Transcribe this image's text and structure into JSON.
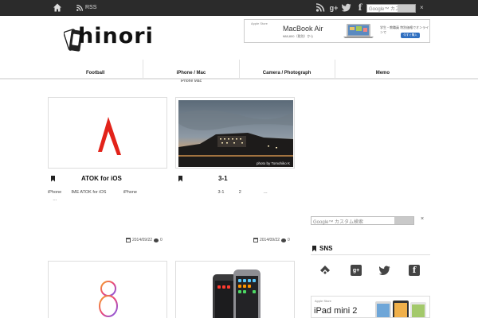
{
  "topbar": {
    "rss_label": "RSS",
    "search_placeholder": "Google™ カス",
    "close_label": "×"
  },
  "header": {
    "logo_text": "hinori",
    "ad": {
      "brand": "Apple Store",
      "title": "MacBook Air",
      "price": "¥88,800（税別）から",
      "small": "学生・教職員 特別価格でオンラインで",
      "button": "今すぐ購入"
    }
  },
  "nav": {
    "items": [
      {
        "label": "Football",
        "sub": ""
      },
      {
        "label": "iPhone / Mac",
        "sub": "iPhone  Mac"
      },
      {
        "label": "Camera / Photograph",
        "sub": ""
      },
      {
        "label": "Memo",
        "sub": ""
      }
    ]
  },
  "posts": [
    {
      "title": "ATOK for iOS",
      "excerpt": "iPhone        IME ATOK for iOS              iPhone\n    …",
      "date": "2014/09/22",
      "comments": "0"
    },
    {
      "title": "3-1",
      "excerpt": "                                   3-1            2                  …",
      "date": "2014/09/22",
      "comments": "0",
      "watermark": "photo by Tomohiko K"
    }
  ],
  "sidebar": {
    "search_placeholder": "Google™ カスタム検索",
    "close_label": "×",
    "sns_title": "SNS",
    "ad": {
      "brand": "Apple Store",
      "title": "iPad mini 2"
    }
  },
  "colors": {
    "topbar": "#2b2b2b",
    "atok_red": "#e2231a",
    "accent_blue": "#2f6fc0"
  }
}
